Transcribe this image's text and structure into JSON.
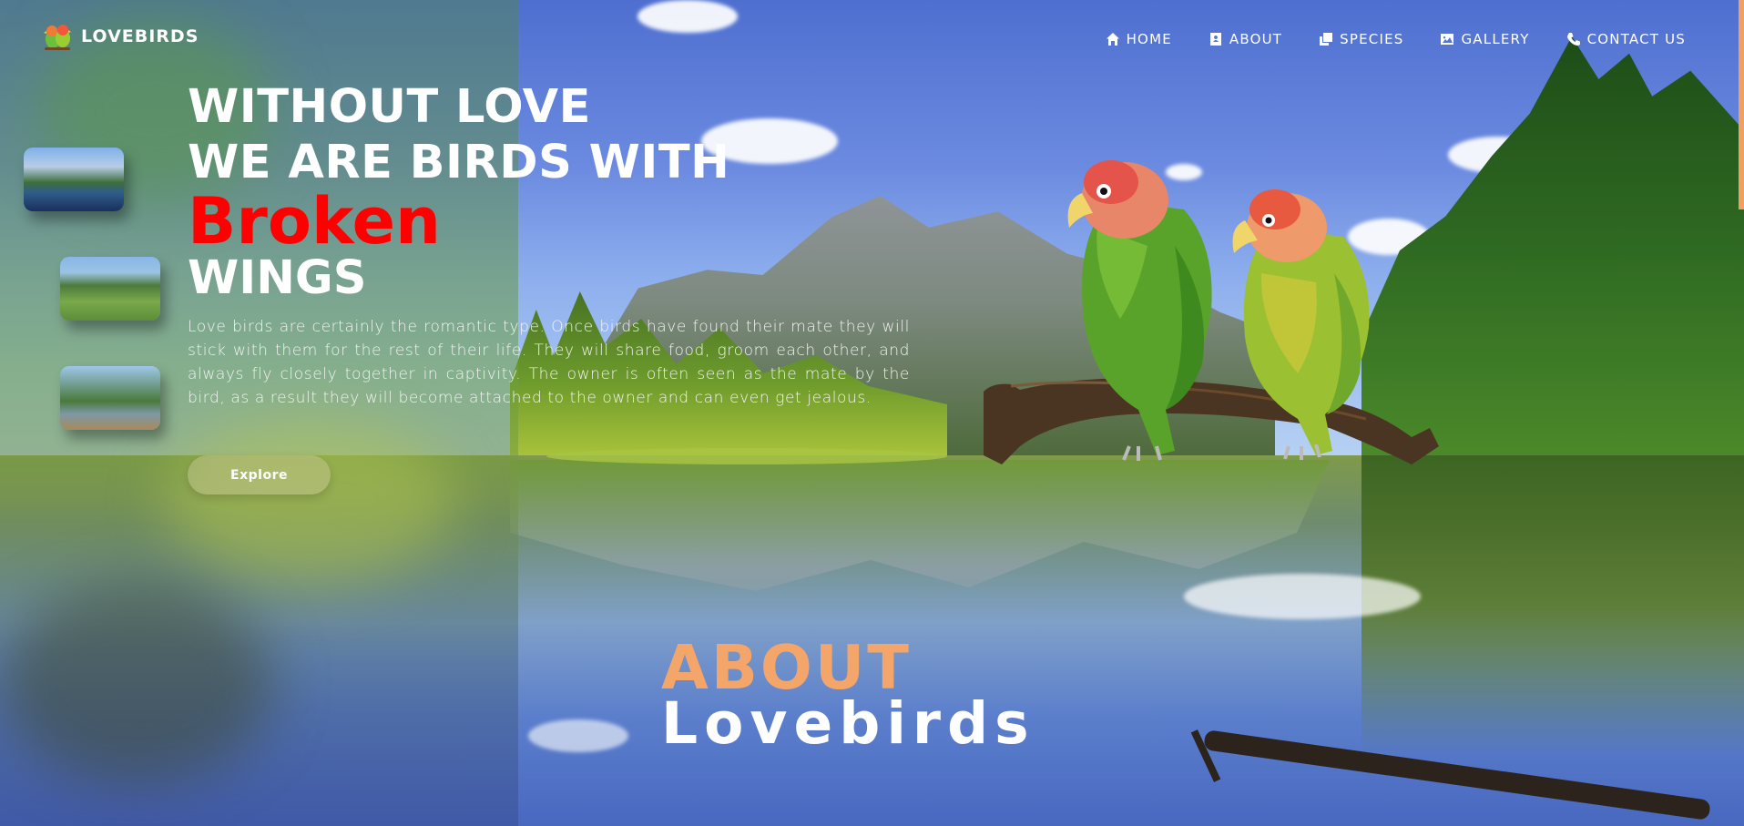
{
  "brand": {
    "name": "LOVEBIRDS",
    "icon": "lovebird-logo-icon"
  },
  "nav": [
    {
      "label": "HOME",
      "icon": "home-icon"
    },
    {
      "label": "ABOUT",
      "icon": "contact-card-icon"
    },
    {
      "label": "SPECIES",
      "icon": "copy-icon"
    },
    {
      "label": "GALLERY",
      "icon": "image-icon"
    },
    {
      "label": "CONTACT US",
      "icon": "phone-icon"
    }
  ],
  "hero": {
    "line1": "WITHOUT LOVE",
    "line2": "WE ARE BIRDS WITH",
    "highlight": "Broken",
    "line3": "WINGS",
    "description": "Love birds are certainly the romantic type. Once birds have found their mate they will stick with them for the rest of their life. They will share food, groom each other, and always fly closely together in captivity. The owner is often seen as the mate by the bird, as a result they will become attached to the owner and can even get jealous.",
    "cta": "Explore",
    "highlight_color": "#ff0000"
  },
  "thumbnails": [
    "lake-mountain-thumbnail",
    "meadow-thumbnail",
    "river-thumbnail"
  ],
  "about": {
    "title": "ABOUT",
    "subtitle": "Lovebirds",
    "title_color": "#f4a56a"
  },
  "colors": {
    "accent": "#f4a56a",
    "scroll_indicator": "#f0a060"
  }
}
